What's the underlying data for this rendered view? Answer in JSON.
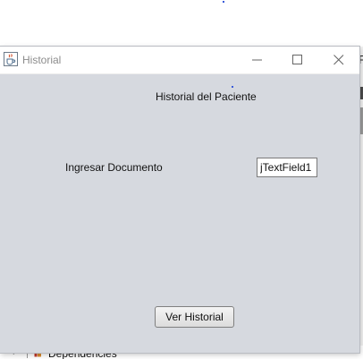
{
  "window": {
    "title": "Historial",
    "icon": "java-cup-icon",
    "controls": [
      "minimize-icon",
      "maximize-icon",
      "close-icon"
    ]
  },
  "form": {
    "heading": "Historial del Paciente",
    "document_label": "Ingresar Documento",
    "document_value": "jTextField1",
    "submit_label": "Ver Historial"
  },
  "background": {
    "tree_item_label": "Dependencies",
    "tree_item_icon": "library-icon",
    "strip_letter": "F"
  },
  "colors": {
    "window_background": "#d6d9df",
    "titlebar_background": "#ffffff",
    "title_text": "#8c8c8c"
  }
}
